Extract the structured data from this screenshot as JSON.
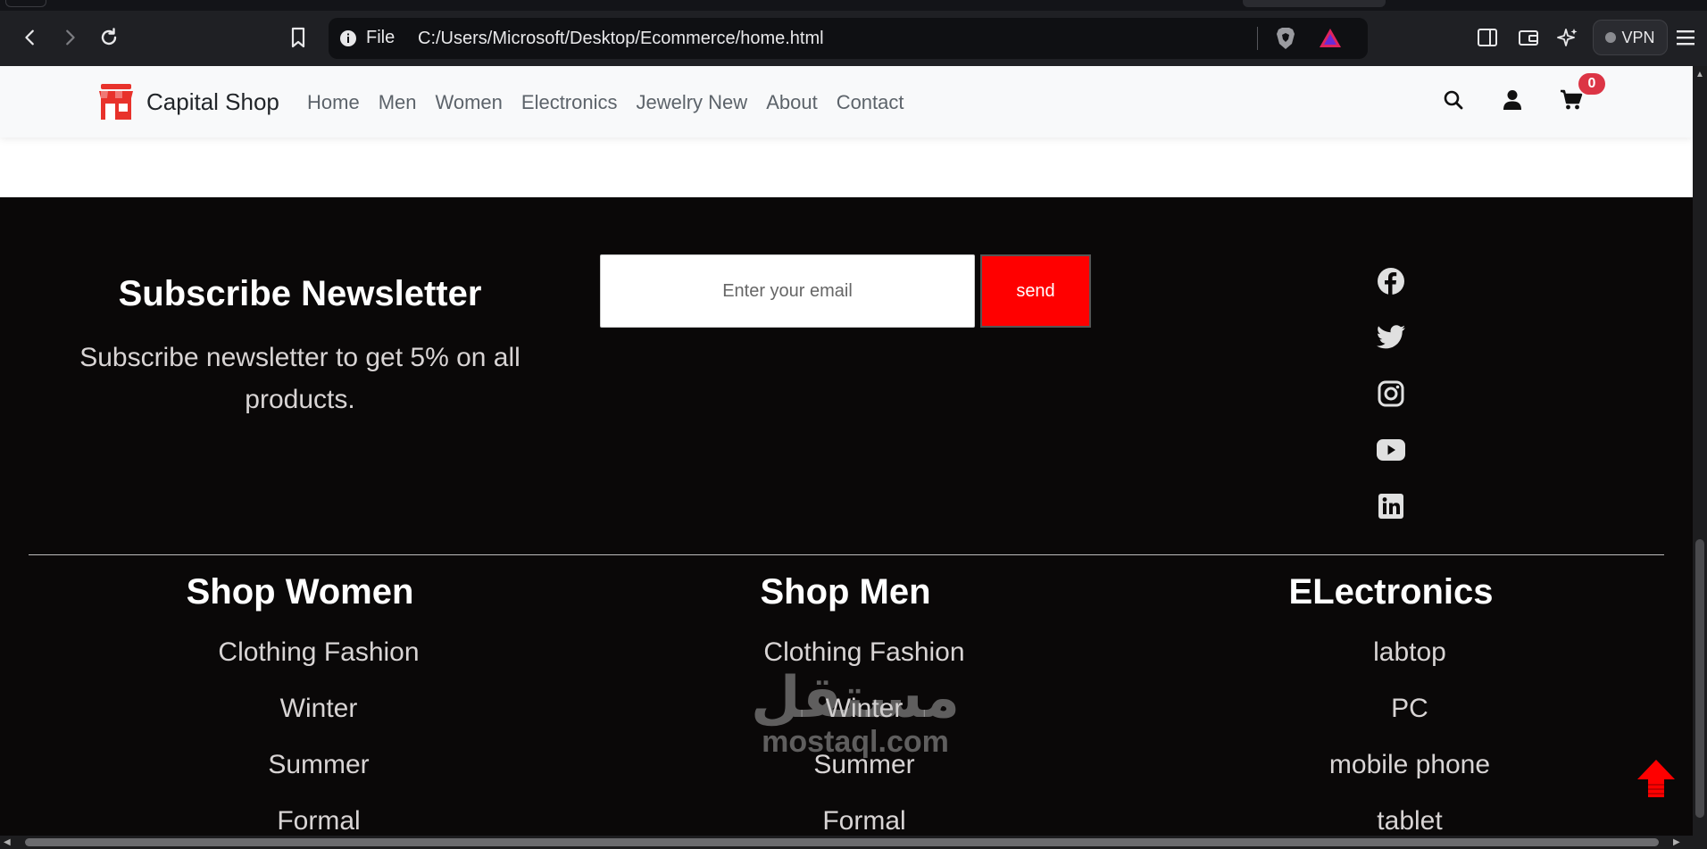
{
  "browser": {
    "url_scheme_label": "File",
    "url": "C:/Users/Microsoft/Desktop/Ecommerce/home.html",
    "vpn_label": "VPN"
  },
  "navbar": {
    "brand": "Capital Shop",
    "menu": [
      "Home",
      "Men",
      "Women",
      "Electronics",
      "Jewelry New",
      "About",
      "Contact"
    ],
    "cart_count": "0"
  },
  "newsletter": {
    "title": "Subscribe Newsletter",
    "subtitle": "Subscribe newsletter to get 5% on all products.",
    "email_placeholder": "Enter your email",
    "send_label": "send"
  },
  "socials": [
    "facebook-icon",
    "twitter-icon",
    "instagram-icon",
    "youtube-icon",
    "linkedin-icon"
  ],
  "footer_columns": [
    {
      "title": "Shop Women",
      "items": [
        "Clothing Fashion",
        "Winter",
        "Summer",
        "Formal"
      ]
    },
    {
      "title": "Shop Men",
      "items": [
        "Clothing Fashion",
        "Winter",
        "Summer",
        "Formal"
      ]
    },
    {
      "title": "ELectronics",
      "items": [
        "labtop",
        "PC",
        "mobile phone",
        "tablet"
      ]
    }
  ],
  "watermark": {
    "arabic": "مستقل",
    "latin": "mostaql.com"
  },
  "colors": {
    "accent": "#ff0000",
    "badge": "#dc3545",
    "footer_bg": "#0a0808"
  }
}
